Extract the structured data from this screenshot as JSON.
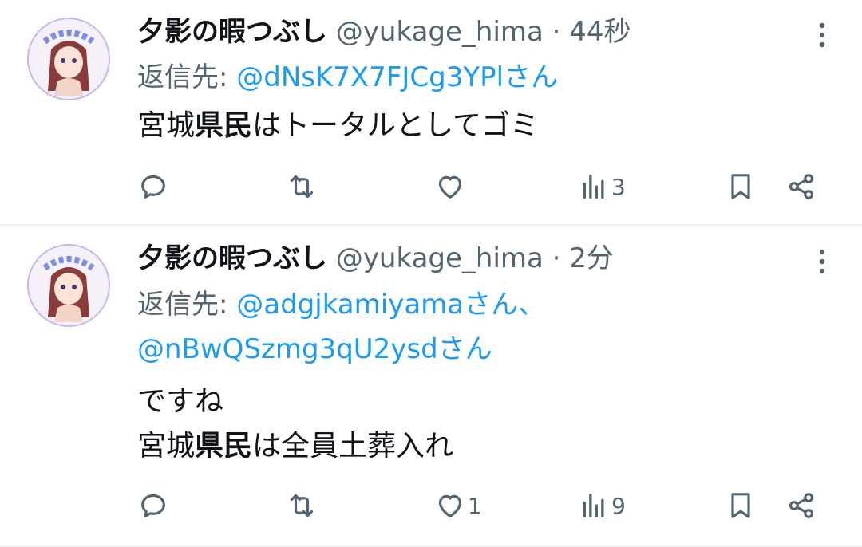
{
  "tweets": [
    {
      "display_name": "夕影の暇つぶし",
      "handle": "@yukage_hima",
      "separator": "·",
      "time": "44秒",
      "reply_prefix": "返信先: ",
      "reply_mentions_line1": "@dNsK7X7FJCg3YPlさん",
      "reply_mentions_line2": "",
      "body_lines": [
        {
          "pre": "宮城",
          "bold": "県民",
          "post": "はトータルとしてゴミ"
        }
      ],
      "counts": {
        "reply": "",
        "retweet": "",
        "like": "",
        "views": "3"
      }
    },
    {
      "display_name": "夕影の暇つぶし",
      "handle": "@yukage_hima",
      "separator": "·",
      "time": "2分",
      "reply_prefix": "返信先: ",
      "reply_mentions_line1": "@adgjkamiyamaさん、",
      "reply_mentions_line2": "@nBwQSzmg3qU2ysdさん",
      "body_lines": [
        {
          "pre": "ですね",
          "bold": "",
          "post": ""
        },
        {
          "pre": "宮城",
          "bold": "県民",
          "post": "は全員土葬入れ"
        }
      ],
      "counts": {
        "reply": "",
        "retweet": "",
        "like": "1",
        "views": "9"
      }
    }
  ],
  "icons": {
    "more": "more-vertical-icon",
    "reply": "reply-bubble-icon",
    "retweet": "retweet-icon",
    "like": "heart-icon",
    "views": "views-bar-chart-icon",
    "bookmark": "bookmark-icon",
    "share": "share-icon"
  },
  "colors": {
    "text": "#0f1419",
    "secondary": "#536471",
    "link": "#1d9bf0",
    "divider": "#eff3f4"
  }
}
